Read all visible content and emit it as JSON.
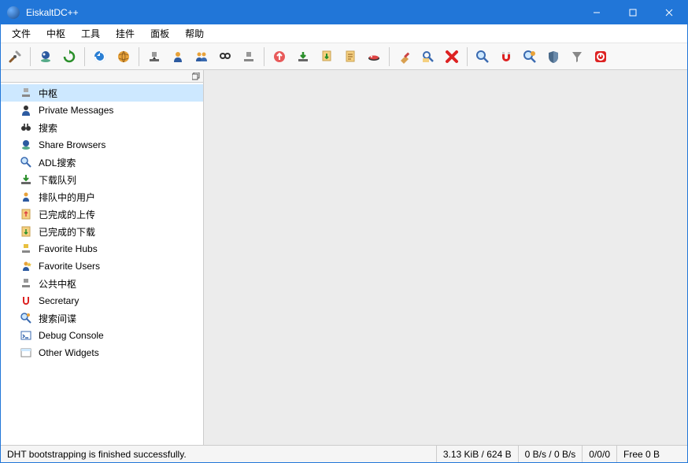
{
  "window": {
    "title": "EiskaltDC++"
  },
  "menu": [
    "文件",
    "中枢",
    "工具",
    "挂件",
    "面板",
    "帮助"
  ],
  "toolbar_icons": [
    "settings-icon",
    "sep",
    "own-filelist-icon",
    "refresh-share-icon",
    "sep",
    "hash-progress-icon",
    "globe-icon",
    "sep",
    "download-queue-icon",
    "favorite-users-icon",
    "users-queue-icon",
    "search-spy-icon",
    "public-hubs-icon",
    "sep",
    "finished-upload-icon",
    "finished-download-icon",
    "download-folder-icon",
    "open-file-icon",
    "hub-icon",
    "sep",
    "clear-icon",
    "adl-search-icon",
    "delete-icon",
    "sep",
    "search-icon",
    "magnet-icon",
    "search-spy2-icon",
    "shield-icon",
    "filter-icon",
    "quit-icon"
  ],
  "sidebar": {
    "items": [
      {
        "icon": "hub-small-icon",
        "label": "中枢",
        "selected": true
      },
      {
        "icon": "user-small-icon",
        "label": "Private Messages"
      },
      {
        "icon": "binoculars-small-icon",
        "label": "搜索"
      },
      {
        "icon": "folder-user-small-icon",
        "label": "Share Browsers"
      },
      {
        "icon": "search-doc-small-icon",
        "label": "ADL搜索"
      },
      {
        "icon": "download-small-icon",
        "label": "下载队列"
      },
      {
        "icon": "users-queue-small-icon",
        "label": "排队中的用户"
      },
      {
        "icon": "upload-done-small-icon",
        "label": "已完成的上传"
      },
      {
        "icon": "download-done-small-icon",
        "label": "已完成的下载"
      },
      {
        "icon": "fav-hub-small-icon",
        "label": "Favorite Hubs"
      },
      {
        "icon": "fav-user-small-icon",
        "label": "Favorite Users"
      },
      {
        "icon": "public-hub-small-icon",
        "label": "公共中枢"
      },
      {
        "icon": "magnet-small-icon",
        "label": "Secretary"
      },
      {
        "icon": "spy-small-icon",
        "label": "搜索间谍"
      },
      {
        "icon": "console-small-icon",
        "label": "Debug Console"
      },
      {
        "icon": "widgets-small-icon",
        "label": "Other Widgets"
      }
    ]
  },
  "status": {
    "message": "DHT bootstrapping is finished successfully.",
    "share": "3.13 KiB / 624 B",
    "speed": "0 B/s / 0 B/s",
    "slots": "0/0/0",
    "free": "Free 0 B"
  }
}
